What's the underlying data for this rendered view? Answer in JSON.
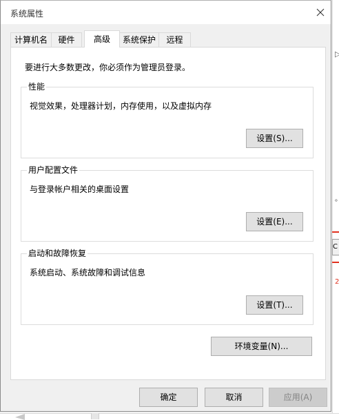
{
  "window": {
    "title": "系统属性"
  },
  "tabs": [
    {
      "label": "计算机名",
      "active": false
    },
    {
      "label": "硬件",
      "active": false
    },
    {
      "label": "高级",
      "active": true
    },
    {
      "label": "系统保护",
      "active": false
    },
    {
      "label": "远程",
      "active": false
    }
  ],
  "advanced": {
    "intro": "要进行大多数更改，你必须作为管理员登录。",
    "performance": {
      "title": "性能",
      "description": "视觉效果，处理器计划，内存使用，以及虚拟内存",
      "button": "设置(S)..."
    },
    "user_profiles": {
      "title": "用户配置文件",
      "description": "与登录帐户相关的桌面设置",
      "button": "设置(E)..."
    },
    "startup_recovery": {
      "title": "启动和故障恢复",
      "description": "系统启动、系统故障和调试信息",
      "button": "设置(T)..."
    },
    "env_button": "环境变量(N)..."
  },
  "footer": {
    "ok": "确定",
    "cancel": "取消",
    "apply": "应用(A)"
  },
  "colors": {
    "dialog_bg": "#f0f0f0",
    "panel_bg": "#ffffff",
    "button_bg": "#e1e1e1",
    "disabled_text": "#838383"
  }
}
